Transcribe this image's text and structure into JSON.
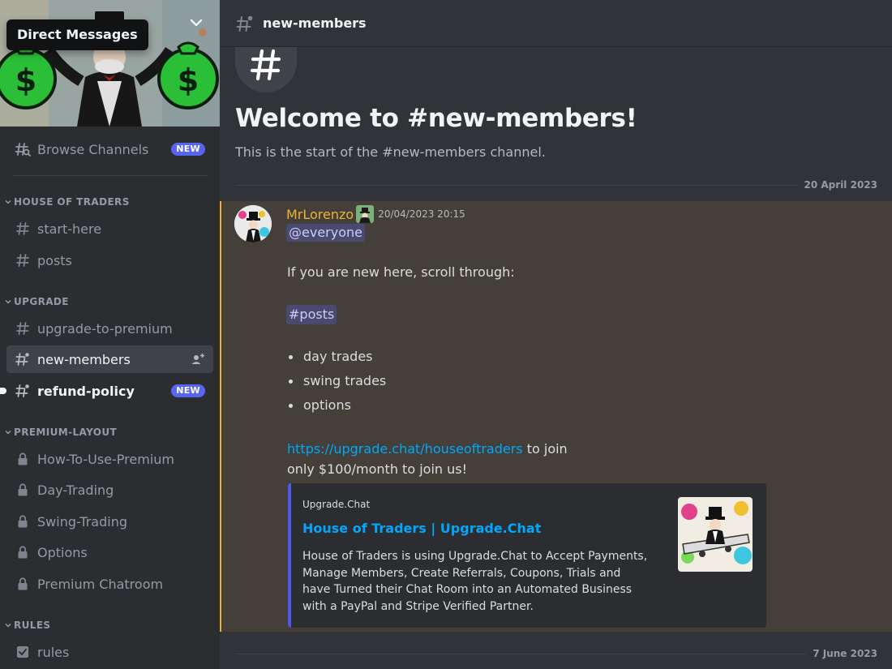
{
  "tooltip": {
    "label": "Direct Messages"
  },
  "sidebar": {
    "browse": {
      "label": "Browse Channels",
      "badge": "NEW"
    },
    "categories": [
      {
        "name": "HOUSE OF TRADERS"
      },
      {
        "name": "UPGRADE"
      },
      {
        "name": "PREMIUM-LAYOUT"
      },
      {
        "name": "RULES"
      }
    ],
    "channels": {
      "start_here": "start-here",
      "posts": "posts",
      "upgrade_to_premium": "upgrade-to-premium",
      "new_members": "new-members",
      "refund_policy": "refund-policy",
      "refund_badge": "NEW",
      "how_to_use_premium": "How-To-Use-Premium",
      "day_trading": "Day-Trading",
      "swing_trading": "Swing-Trading",
      "options": "Options",
      "premium_chatroom": "Premium Chatroom",
      "rules": "rules"
    }
  },
  "header": {
    "channel": "new-members"
  },
  "welcome": {
    "title": "Welcome to #new-members!",
    "subtitle": "This is the start of the #new-members channel."
  },
  "date_dividers": [
    "20 April 2023",
    "7 June 2023"
  ],
  "message": {
    "author": "MrLorenzo",
    "timestamp": "20/04/2023 20:15",
    "mention": "@everyone",
    "line1": "If you are new here, scroll through:",
    "channel_mention": "#posts",
    "bullets": [
      "day trades",
      "swing trades",
      "options"
    ],
    "link": "https://upgrade.chat/houseoftraders",
    "link_suffix": " to join",
    "line_price": "only $100/month to join us!",
    "embed": {
      "provider": "Upgrade.Chat",
      "title": "House of Traders | Upgrade.Chat",
      "description": "House of Traders is using Upgrade.Chat to Accept Payments, Manage Members, Create Referrals, Coupons, Trials and have Turned their Chat Room into an Automated Business with a PayPal and Stripe Verified Partner."
    }
  },
  "colors": {
    "accent": "#5865f2",
    "highlight_border": "#f0b232",
    "link": "#00a8fc",
    "sidebar_bg": "#2b2d31",
    "main_bg": "#313338"
  }
}
